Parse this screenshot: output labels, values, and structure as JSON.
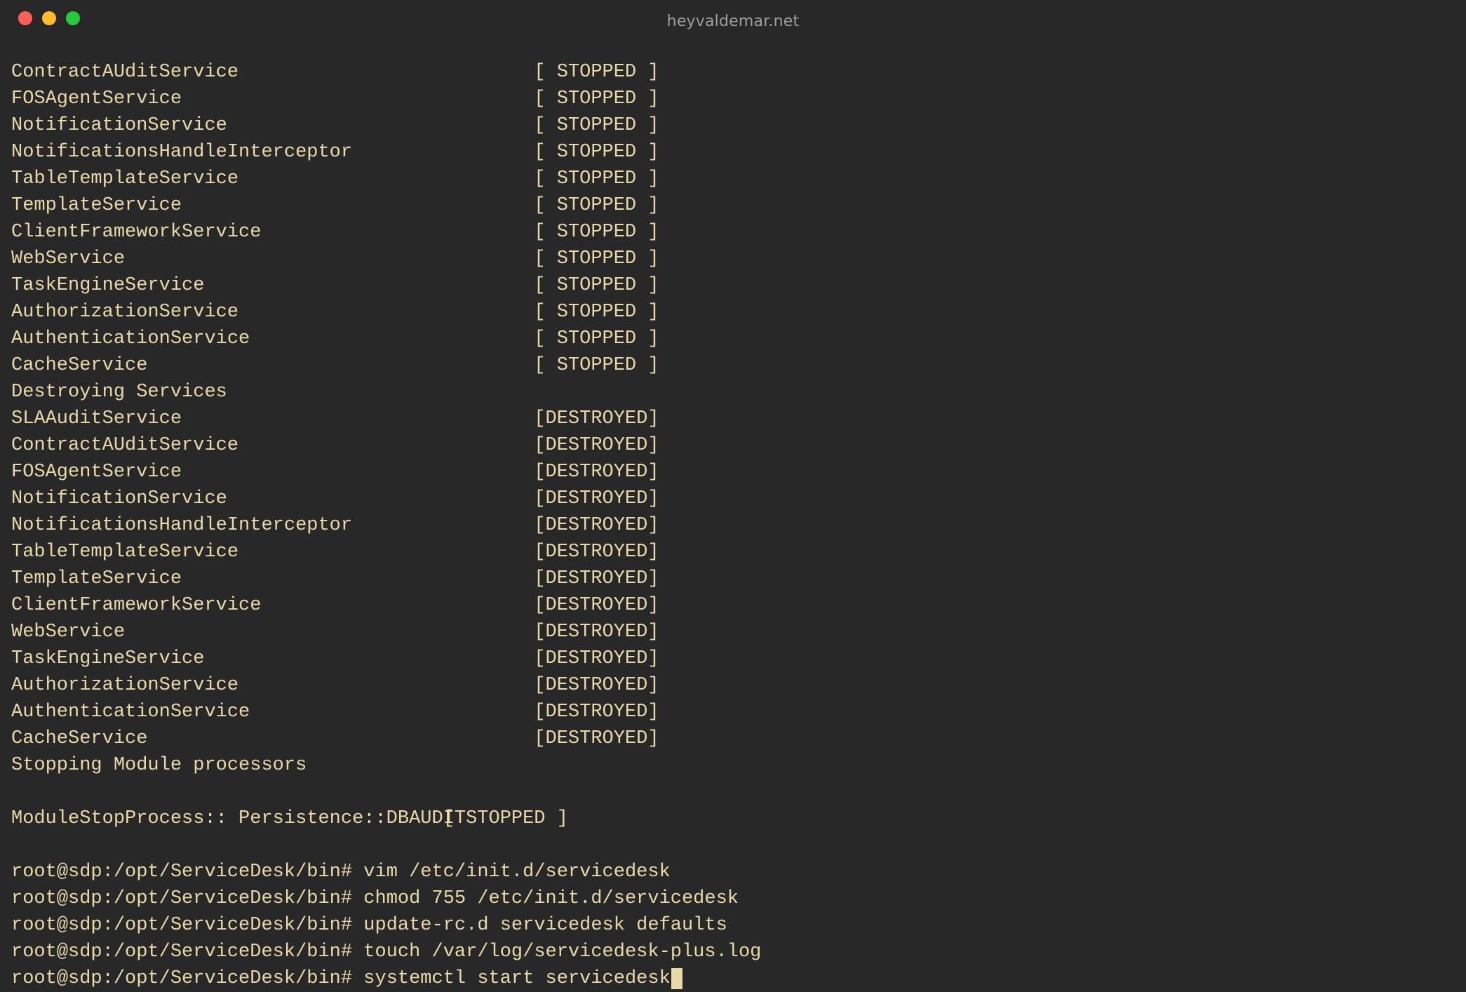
{
  "window": {
    "title": "heyvaldemar.net"
  },
  "status_labels": {
    "stopped": "[ STOPPED ]",
    "destroyed": "[DESTROYED]",
    "module_stopped": "[ STOPPED ]"
  },
  "stopped_services": [
    "ContractAUditService",
    "FOSAgentService",
    "NotificationService",
    "NotificationsHandleInterceptor",
    "TableTemplateService",
    "TemplateService",
    "ClientFrameworkService",
    "WebService",
    "TaskEngineService",
    "AuthorizationService",
    "AuthenticationService",
    "CacheService"
  ],
  "destroy_header": "Destroying Services",
  "destroyed_services": [
    "SLAAuditService",
    "ContractAUditService",
    "FOSAgentService",
    "NotificationService",
    "NotificationsHandleInterceptor",
    "TableTemplateService",
    "TemplateService",
    "ClientFrameworkService",
    "WebService",
    "TaskEngineService",
    "AuthorizationService",
    "AuthenticationService",
    "CacheService"
  ],
  "stopping_module_header": "Stopping Module processors",
  "module_stop": {
    "name": "ModuleStopProcess:: Persistence::DBAUDIT"
  },
  "prompt": "root@sdp:/opt/ServiceDesk/bin# ",
  "history": [
    "vim /etc/init.d/servicedesk",
    "chmod 755 /etc/init.d/servicedesk",
    "update-rc.d servicedesk defaults",
    "touch /var/log/servicedesk-plus.log"
  ],
  "current_command": "systemctl start servicedesk"
}
